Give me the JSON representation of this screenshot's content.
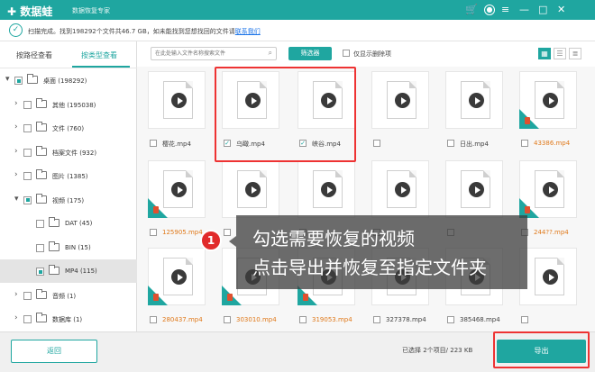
{
  "app": {
    "title": "数据蛙",
    "subtitle": "数据恢复专家",
    "colors": {
      "accent": "#1fa6a0",
      "highlight": "#e33333",
      "deleted_name": "#e07a1c"
    },
    "icons": [
      "cart-icon",
      "user-icon",
      "menu-icon",
      "minimize-icon",
      "maximize-icon",
      "close-icon"
    ]
  },
  "infobar": {
    "text": "扫描完成。找到198292个文件共46.7 GB，如未能找到您想找回的文件请",
    "link": "联系我们"
  },
  "sidebar": {
    "tab_path": "按路径查看",
    "tab_type": "按类型查看",
    "tree": [
      {
        "label": "桌面 (198292)",
        "level": 0,
        "arrow": "▾",
        "partial": true
      },
      {
        "label": "其他 (195038)",
        "level": 1,
        "arrow": "›",
        "partial": false
      },
      {
        "label": "文件 (760)",
        "level": 1,
        "arrow": "›",
        "partial": false
      },
      {
        "label": "档案文件 (932)",
        "level": 1,
        "arrow": "›",
        "partial": false
      },
      {
        "label": "图片 (1385)",
        "level": 1,
        "arrow": "›",
        "partial": false
      },
      {
        "label": "视频 (175)",
        "level": 1,
        "arrow": "▾",
        "partial": true
      },
      {
        "label": "DAT (45)",
        "level": 2,
        "arrow": "",
        "partial": false
      },
      {
        "label": "BIN (15)",
        "level": 2,
        "arrow": "",
        "partial": false
      },
      {
        "label": "MP4 (115)",
        "level": 2,
        "arrow": "",
        "partial": true,
        "selected": true
      },
      {
        "label": "音频 (1)",
        "level": 1,
        "arrow": "›",
        "partial": false
      },
      {
        "label": "数据库 (1)",
        "level": 1,
        "arrow": "›",
        "partial": false
      }
    ]
  },
  "toolbar": {
    "search_placeholder": "在此处输入文件名称搜索文件",
    "filter_label": "筛选器",
    "deleted_only_label": "仅显示删除项"
  },
  "files": [
    {
      "name": "樱花.mp4",
      "checked": false,
      "deleted": false
    },
    {
      "name": "乌瞰.mp4",
      "checked": true,
      "deleted": false
    },
    {
      "name": "峡谷.mp4",
      "checked": true,
      "deleted": false
    },
    {
      "name": "",
      "checked": false,
      "deleted": false
    },
    {
      "name": "日出.mp4",
      "checked": false,
      "deleted": false
    },
    {
      "name": "43386.mp4",
      "checked": false,
      "deleted": true
    },
    {
      "name": "77694.mp4",
      "checked": false,
      "deleted": true
    },
    {
      "name": "125905.mp4",
      "checked": false,
      "deleted": true
    },
    {
      "name": "",
      "checked": false,
      "deleted": false
    },
    {
      "name": "",
      "checked": false,
      "deleted": false
    },
    {
      "name": "",
      "checked": false,
      "deleted": false
    },
    {
      "name": "",
      "checked": false,
      "deleted": false
    },
    {
      "name": "244??.mp4",
      "checked": false,
      "deleted": true
    },
    {
      "name": "245106.mp4",
      "checked": false,
      "deleted": true
    },
    {
      "name": "280437.mp4",
      "checked": false,
      "deleted": true
    },
    {
      "name": "303010.mp4",
      "checked": false,
      "deleted": true
    },
    {
      "name": "319053.mp4",
      "checked": false,
      "deleted": true
    },
    {
      "name": "327378.mp4",
      "checked": false,
      "deleted": false
    },
    {
      "name": "385468.mp4",
      "checked": false,
      "deleted": false
    },
    {
      "name": "",
      "checked": false,
      "deleted": false
    },
    {
      "name": "439625.mp4",
      "checked": false,
      "deleted": true
    }
  ],
  "overlay": {
    "number": "1",
    "line1": "勾选需要恢复的视频",
    "line2": "点击导出并恢复至指定文件夹"
  },
  "bottombar": {
    "back_label": "返回",
    "status": "已选择 2个项目/ 223 KB",
    "export_label": "导出"
  }
}
